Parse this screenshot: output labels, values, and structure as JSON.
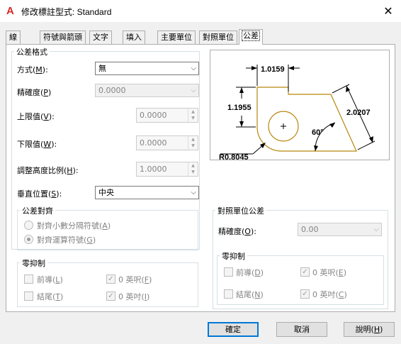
{
  "window": {
    "app_icon_glyph": "A",
    "title": "修改標註型式: Standard",
    "close_glyph": "✕"
  },
  "tabs": [
    {
      "label": "線"
    },
    {
      "label": "符號與箭頭"
    },
    {
      "label": "文字"
    },
    {
      "label": "填入"
    },
    {
      "label": "主要單位"
    },
    {
      "label": "對照單位"
    },
    {
      "label": "公差"
    }
  ],
  "tolerance_format": {
    "group_title": "公差格式",
    "method_label": "方式(",
    "method_key": "M",
    "method_value": "無",
    "precision_label": "精確度(",
    "precision_key": "P",
    "precision_value": "0.0000",
    "upper_label": "上限值(",
    "upper_key": "V",
    "upper_value": "0.0000",
    "lower_label": "下限值(",
    "lower_key": "W",
    "lower_value": "0.0000",
    "scale_label": "調整高度比例(",
    "scale_key": "H",
    "scale_value": "1.0000",
    "vpos_label": "垂直位置(",
    "vpos_key": "S",
    "vpos_value": "中央"
  },
  "alignment": {
    "group_title": "公差對齊",
    "opt1_label": "對齊小數分隔符號(",
    "opt1_key": "A",
    "opt2_label": "對齊運算符號(",
    "opt2_key": "G",
    "selected": 2
  },
  "zero_left": {
    "group_title": "零抑制",
    "leading_label": "前導(",
    "leading_key": "L",
    "trailing_label": "結尾(",
    "trailing_key": "T",
    "feet_label": "0 英呎(",
    "feet_key": "F",
    "inches_label": "0 英吋(",
    "inches_key": "I",
    "leading_checked": false,
    "trailing_checked": false,
    "feet_checked": true,
    "inches_checked": true
  },
  "alt_tolerance": {
    "group_title": "對照單位公差",
    "precision_label": "精確度(",
    "precision_key": "O",
    "precision_value": "0.00"
  },
  "zero_right": {
    "group_title": "零抑制",
    "leading_label": "前導(",
    "leading_key": "D",
    "trailing_label": "結尾(",
    "trailing_key": "N",
    "feet_label": "0 英呎(",
    "feet_key": "E",
    "inches_label": "0 英吋(",
    "inches_key": "C",
    "leading_checked": false,
    "trailing_checked": false,
    "feet_checked": true,
    "inches_checked": true
  },
  "preview": {
    "dim_top": "1.0159",
    "dim_left": "1.1955",
    "dim_right": "2.0207",
    "angle": "60°",
    "radius": "R0.8045"
  },
  "buttons": {
    "ok": "確定",
    "cancel": "取消",
    "help_label": "說明(",
    "help_key": "H"
  },
  "icons": {
    "combo_arrow": "⌵",
    "check_mark": "✓",
    "spin_up": "▲",
    "spin_down": "▼"
  }
}
